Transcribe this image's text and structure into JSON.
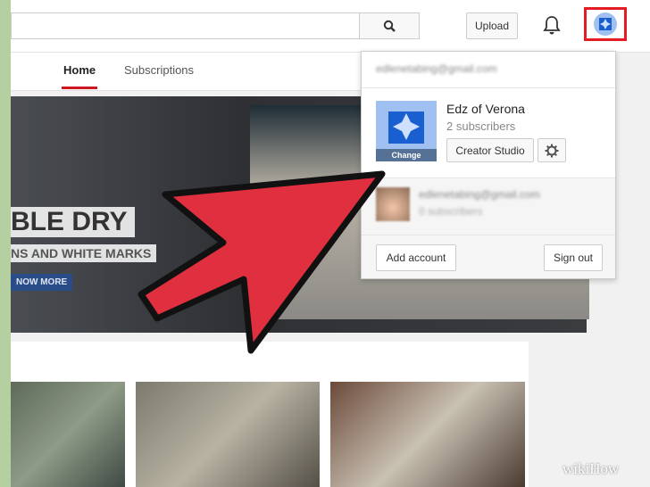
{
  "header": {
    "upload_label": "Upload",
    "search_placeholder": ""
  },
  "tabs": [
    {
      "label": "Home",
      "active": true
    },
    {
      "label": "Subscriptions",
      "active": false
    }
  ],
  "hero": {
    "headline": "BLE DRY",
    "subline": "NS AND WHITE MARKS",
    "cta": "NOW MORE"
  },
  "account_menu": {
    "email": "edlenetabing@gmail.com",
    "channel_name": "Edz of Verona",
    "subscribers": "2 subscribers",
    "change_label": "Change",
    "creator_studio_label": "Creator Studio",
    "other_account": {
      "email": "edlenetabing@gmail.com",
      "subscribers": "0 subscribers"
    },
    "add_account_label": "Add account",
    "sign_out_label": "Sign out"
  },
  "watermark": "wikiHow",
  "colors": {
    "highlight": "#e31b23",
    "arrow": "#e0303f",
    "accent": "#cc181e"
  }
}
